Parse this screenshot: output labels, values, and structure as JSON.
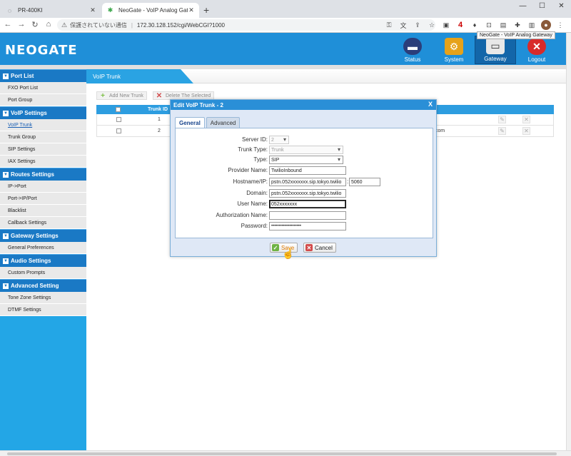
{
  "browser": {
    "tabs": [
      {
        "title": "PR-400KI",
        "active": false
      },
      {
        "title": "NeoGate - VoIP Analog Gateway",
        "active": true
      }
    ],
    "new_tab": "+",
    "window_controls": {
      "minimize": "—",
      "maximize": "☐",
      "close": "✕"
    },
    "address": {
      "security_warning": "保護されていない通信",
      "url": "172.30.128.152/cgi/WebCGI?1000"
    },
    "tooltip": "NeoGate - VoIP Analog Gateway",
    "extensions": {
      "badge": "4"
    }
  },
  "app": {
    "logo": "NEOGATE",
    "top_nav": [
      {
        "label": "Status",
        "icon": "status-icon",
        "active": false
      },
      {
        "label": "System",
        "icon": "system-icon",
        "active": false
      },
      {
        "label": "Gateway",
        "icon": "gateway-icon",
        "active": true
      },
      {
        "label": "Logout",
        "icon": "logout-icon",
        "active": false
      }
    ]
  },
  "sidebar": {
    "sections": [
      {
        "title": "Port List",
        "items": [
          "FXO Port List",
          "Port Group"
        ]
      },
      {
        "title": "VoIP Settings",
        "items": [
          "VoIP Trunk",
          "Trunk Group",
          "SIP Settings",
          "IAX Settings"
        ]
      },
      {
        "title": "Routes Settings",
        "items": [
          "IP->Port",
          "Port->IP/Port",
          "Blacklist",
          "Callback Settings"
        ]
      },
      {
        "title": "Gateway Settings",
        "items": [
          "General Preferences"
        ]
      },
      {
        "title": "Audio Settings",
        "items": [
          "Custom Prompts"
        ]
      },
      {
        "title": "Advanced Setting",
        "items": [
          "Tone Zone Settings",
          "DTMF Settings"
        ]
      }
    ],
    "active_item": "VoIP Trunk"
  },
  "main": {
    "breadcrumb": "VoIP Trunk",
    "toolbar": {
      "add": "Add New Trunk",
      "delete": "Delete The Selected"
    },
    "grid": {
      "header_trunk_id": "Trunk ID",
      "rows": [
        {
          "id": "1",
          "host_suffix": ""
        },
        {
          "id": "2",
          "host_suffix": "o.com"
        }
      ]
    }
  },
  "dialog": {
    "title": "Edit VoIP Trunk - 2",
    "close": "X",
    "tabs": [
      "General",
      "Advanced"
    ],
    "fields": {
      "server_id": {
        "label": "Server ID:",
        "value": "2"
      },
      "trunk_type": {
        "label": "Trunk Type:",
        "value": "Trunk"
      },
      "type": {
        "label": "Type:",
        "value": "SIP"
      },
      "provider_name": {
        "label": "Provider Name:",
        "value": "TwilioInbound"
      },
      "hostname": {
        "label": "Hostname/IP:",
        "value": "pstn.052xxxxxxx.sip.tokyo.twilio",
        "port": "5060",
        "port_sep": ":"
      },
      "domain": {
        "label": "Domain:",
        "value": "pstn.052xxxxxxx.sip.tokyo.twilio"
      },
      "user_name": {
        "label": "User Name:",
        "value": "052xxxxxxx"
      },
      "auth_name": {
        "label": "Authorization Name:",
        "value": ""
      },
      "password": {
        "label": "Password:",
        "value": "••••••••••••••••••••"
      }
    },
    "buttons": {
      "save": "Save",
      "cancel": "Cancel"
    }
  }
}
